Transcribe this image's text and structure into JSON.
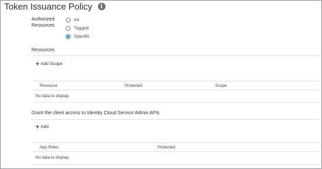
{
  "title": "Token Issuance Policy",
  "info_icon": "info-icon",
  "authorized": {
    "label_line1": "Authorized",
    "label_line2": "Resources",
    "options": [
      {
        "label": "All",
        "checked": false
      },
      {
        "label": "Tagged",
        "checked": false
      },
      {
        "label": "Specific",
        "checked": true
      }
    ]
  },
  "resources": {
    "title": "Resources",
    "add_label": "Add Scope",
    "columns": [
      "Resource",
      "Protected",
      "Scope"
    ],
    "empty_text": "No data to display."
  },
  "grant": {
    "title": "Grant the client access to Identity Cloud Service Admin APIs",
    "add_label": "Add",
    "columns": [
      "App Roles",
      "Protected"
    ],
    "empty_text": "No data to display."
  }
}
